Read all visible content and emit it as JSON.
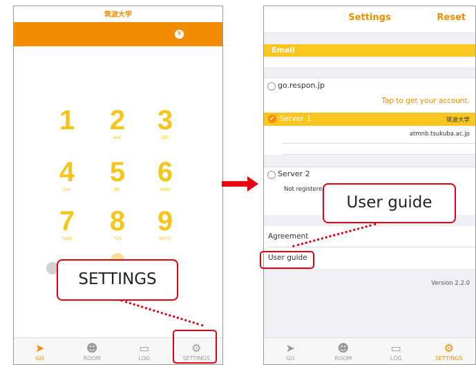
{
  "left_screen": {
    "header_title": "筑波大学",
    "clear_button_symbol": "✕",
    "keypad": [
      {
        "digit": "1",
        "letters": ""
      },
      {
        "digit": "2",
        "letters": "ABC"
      },
      {
        "digit": "3",
        "letters": "DEF"
      },
      {
        "digit": "4",
        "letters": "GHI"
      },
      {
        "digit": "5",
        "letters": "JKL"
      },
      {
        "digit": "6",
        "letters": "MNO"
      },
      {
        "digit": "7",
        "letters": "PQRS"
      },
      {
        "digit": "8",
        "letters": "TUV"
      },
      {
        "digit": "9",
        "letters": "WXYZ"
      }
    ]
  },
  "right_screen": {
    "title": "Settings",
    "reset_label": "Reset",
    "email_section_label": "Email",
    "respon_option": "go.respon.jp",
    "tap_account_link": "Tap to get your account.",
    "server1_label": "Server 1",
    "server1_tag": "筑波大学",
    "server1_host": "atmnb.tsukuba.ac.jp",
    "server2_label": "Server 2",
    "server2_status": "Not registered",
    "agreement_label": "Agreement",
    "user_guide_label": "User guide",
    "version": "Version 2.2.0"
  },
  "tabs": [
    {
      "label": "GO",
      "icon": "paper-plane-icon"
    },
    {
      "label": "ROOM",
      "icon": "smile-icon"
    },
    {
      "label": "LOG",
      "icon": "trash-can-icon"
    },
    {
      "label": "SETTINGS",
      "icon": "gear-icon"
    }
  ],
  "callouts": {
    "settings": "SETTINGS",
    "user_guide": "User guide"
  },
  "colors": {
    "accent_orange": "#f28c00",
    "accent_yellow": "#f9c520",
    "annotation_red": "#e00012"
  }
}
